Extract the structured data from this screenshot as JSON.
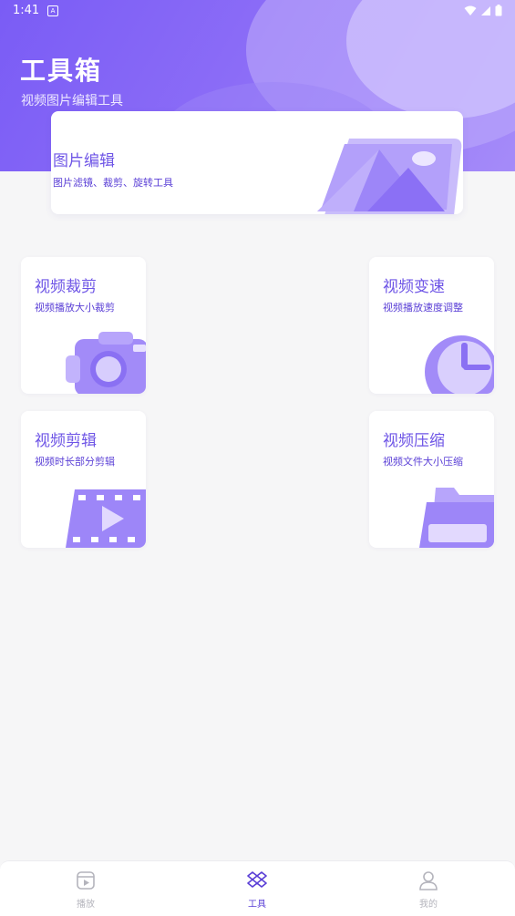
{
  "status_bar": {
    "time": "1:41",
    "notification_glyph": "A"
  },
  "header": {
    "title": "工具箱",
    "subtitle": "视频图片编辑工具"
  },
  "feature": {
    "title": "图片编辑",
    "description": "图片滤镜、裁剪、旋转工具",
    "icon": "image-photo-icon"
  },
  "tools": [
    {
      "title": "视频裁剪",
      "description": "视频播放大小裁剪",
      "icon": "camera-icon"
    },
    {
      "title": "视频变速",
      "description": "视频播放速度调整",
      "icon": "clock-icon"
    },
    {
      "title": "视频剪辑",
      "description": "视频时长部分剪辑",
      "icon": "film-play-icon"
    },
    {
      "title": "视频压缩",
      "description": "视频文件大小压缩",
      "icon": "folder-icon"
    }
  ],
  "nav": [
    {
      "label": "播放",
      "icon": "play-icon",
      "active": false
    },
    {
      "label": "工具",
      "icon": "toolbox-icon",
      "active": true
    },
    {
      "label": "我的",
      "icon": "user-icon",
      "active": false
    }
  ],
  "colors": {
    "accent": "#6e55e6",
    "nav_active": "#5a3fd6",
    "nav_inactive": "#b4b4bc",
    "hero_gradient_start": "#7a5cf5",
    "hero_gradient_end": "#a58bf9"
  }
}
